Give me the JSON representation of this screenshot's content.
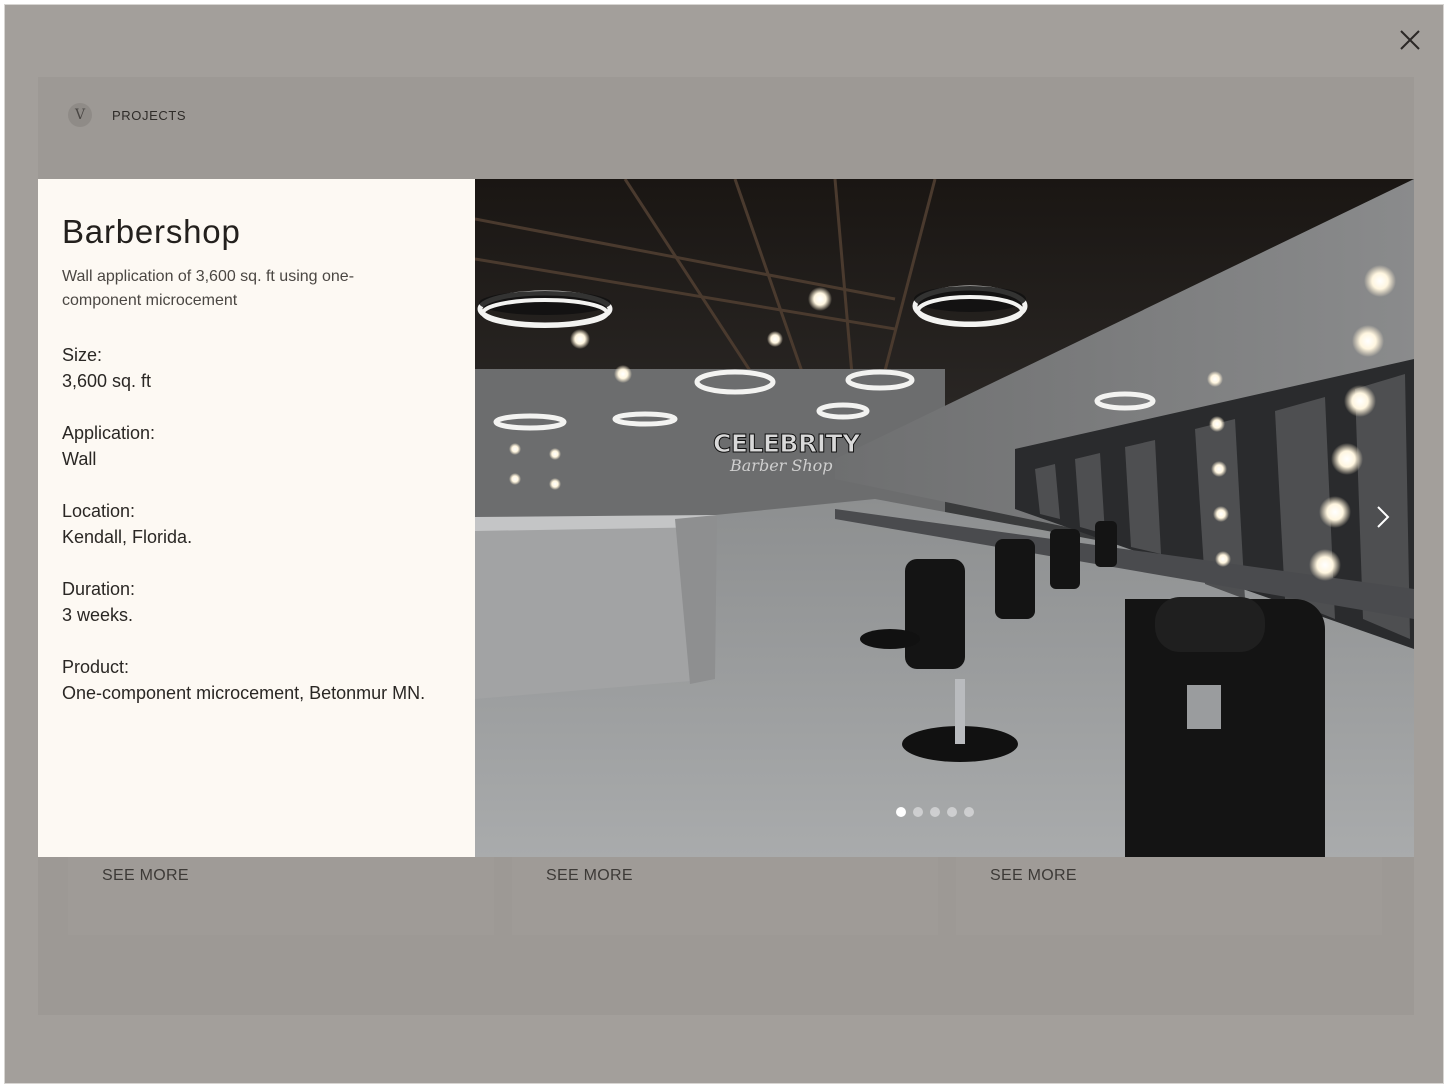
{
  "page": {
    "nav_label": "PROJECTS",
    "logo_letter": "V",
    "cards": [
      {
        "cta": "SEE MORE"
      },
      {
        "cta": "SEE MORE"
      },
      {
        "cta": "SEE MORE"
      }
    ]
  },
  "modal": {
    "title": "Barbershop",
    "summary": "Wall application of 3,600 sq. ft using one-component microcement",
    "specs": [
      {
        "label": "Size:",
        "value": "3,600 sq. ft"
      },
      {
        "label": "Application:",
        "value": "Wall"
      },
      {
        "label": "Location:",
        "value": "Kendall, Florida."
      },
      {
        "label": "Duration:",
        "value": "3 weeks."
      },
      {
        "label": "Product:",
        "value": "One-component microcement, Betonmur MN."
      }
    ],
    "gallery": {
      "sign_main": "CELEBRITY",
      "sign_script": "Barber Shop",
      "slide_count": 5,
      "active_slide": 1
    },
    "icons": {
      "close": "close-icon",
      "next": "chevron-right-icon"
    }
  },
  "colors": {
    "overlay": "#a39f9b",
    "panel": "#fdf9f3",
    "text": "#2a2724"
  }
}
